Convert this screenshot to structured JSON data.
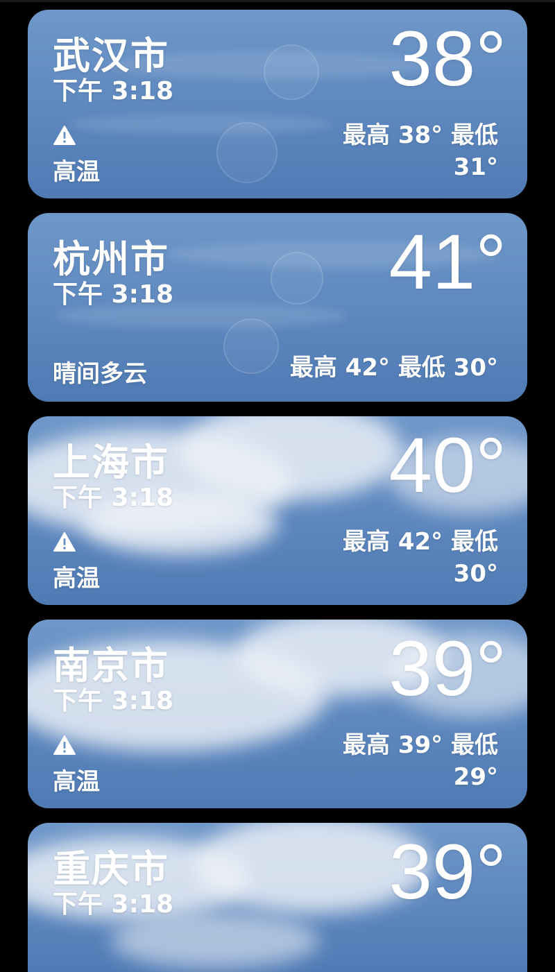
{
  "cities": [
    {
      "name": "武汉市",
      "time": "下午 3:18",
      "temp": "38°",
      "alert": true,
      "condition": "高温",
      "hilo": "最高 38° 最低 31°"
    },
    {
      "name": "杭州市",
      "time": "下午 3:18",
      "temp": "41°",
      "alert": false,
      "condition": "晴间多云",
      "hilo": "最高 42° 最低 30°"
    },
    {
      "name": "上海市",
      "time": "下午 3:18",
      "temp": "40°",
      "alert": true,
      "condition": "高温",
      "hilo": "最高 42° 最低 30°"
    },
    {
      "name": "南京市",
      "time": "下午 3:18",
      "temp": "39°",
      "alert": true,
      "condition": "高温",
      "hilo": "最高 39° 最低 29°"
    },
    {
      "name": "重庆市",
      "time": "下午 3:18",
      "temp": "39°"
    }
  ],
  "alert_icon": "warning-triangle-icon",
  "colors": {
    "card_top": "#6f97c9",
    "card_bottom": "#4f7ab4",
    "cloud": "#eef2f8",
    "text": "#ffffff",
    "background": "#000000"
  }
}
